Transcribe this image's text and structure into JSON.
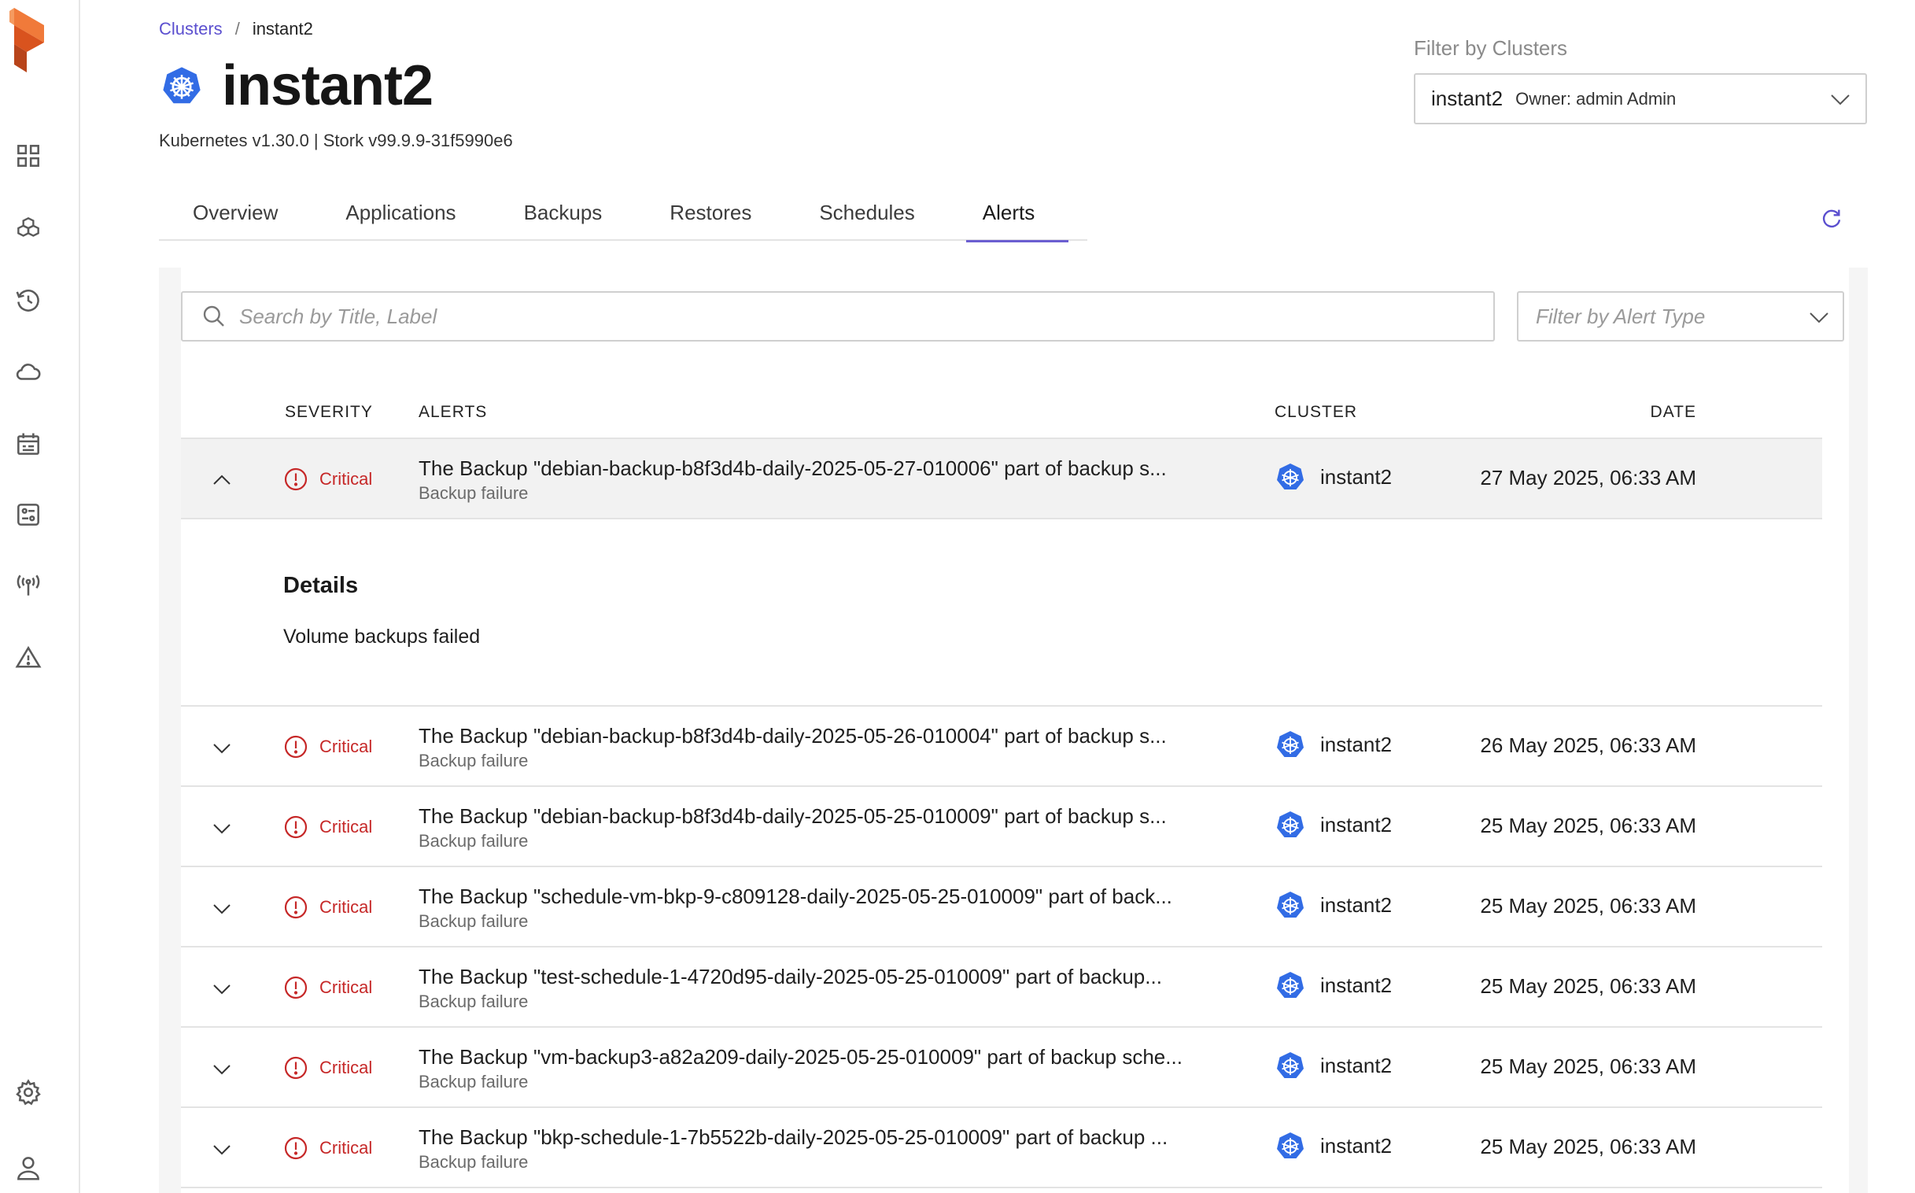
{
  "breadcrumb": {
    "parent": "Clusters",
    "separator": "/",
    "current": "instant2"
  },
  "cluster": {
    "name": "instant2",
    "version_line": "Kubernetes v1.30.0 | Stork v99.9.9-31f5990e6"
  },
  "cluster_filter": {
    "label": "Filter by Clusters",
    "selected_name": "instant2",
    "selected_owner": "Owner: admin Admin"
  },
  "tabs": [
    {
      "label": "Overview"
    },
    {
      "label": "Applications"
    },
    {
      "label": "Backups"
    },
    {
      "label": "Restores"
    },
    {
      "label": "Schedules"
    },
    {
      "label": "Alerts"
    }
  ],
  "active_tab": "Alerts",
  "search": {
    "placeholder": "Search by Title, Label"
  },
  "alert_type_filter": {
    "placeholder": "Filter by Alert Type"
  },
  "table": {
    "headers": {
      "severity": "SEVERITY",
      "alerts": "ALERTS",
      "cluster": "CLUSTER",
      "date": "DATE"
    },
    "expanded": {
      "severity": "Critical",
      "title": "The Backup \"debian-backup-b8f3d4b-daily-2025-05-27-010006\" part of backup s...",
      "type": "Backup failure",
      "cluster": "instant2",
      "date": "27 May 2025, 06:33 AM",
      "details_heading": "Details",
      "details_text": "Volume backups failed"
    },
    "rows": [
      {
        "severity": "Critical",
        "title": "The Backup \"debian-backup-b8f3d4b-daily-2025-05-26-010004\" part of backup s...",
        "type": "Backup failure",
        "cluster": "instant2",
        "date": "26 May 2025, 06:33 AM"
      },
      {
        "severity": "Critical",
        "title": "The Backup \"debian-backup-b8f3d4b-daily-2025-05-25-010009\" part of backup s...",
        "type": "Backup failure",
        "cluster": "instant2",
        "date": "25 May 2025, 06:33 AM"
      },
      {
        "severity": "Critical",
        "title": "The Backup \"schedule-vm-bkp-9-c809128-daily-2025-05-25-010009\" part of back...",
        "type": "Backup failure",
        "cluster": "instant2",
        "date": "25 May 2025, 06:33 AM"
      },
      {
        "severity": "Critical",
        "title": "The Backup \"test-schedule-1-4720d95-daily-2025-05-25-010009\" part of backup...",
        "type": "Backup failure",
        "cluster": "instant2",
        "date": "25 May 2025, 06:33 AM"
      },
      {
        "severity": "Critical",
        "title": "The Backup \"vm-backup3-a82a209-daily-2025-05-25-010009\" part of backup sche...",
        "type": "Backup failure",
        "cluster": "instant2",
        "date": "25 May 2025, 06:33 AM"
      },
      {
        "severity": "Critical",
        "title": "The Backup \"bkp-schedule-1-7b5522b-daily-2025-05-25-010009\" part of backup ...",
        "type": "Backup failure",
        "cluster": "instant2",
        "date": "25 May 2025, 06:33 AM"
      }
    ]
  },
  "colors": {
    "accent": "#6b5ed1",
    "link": "#5b4fcf",
    "critical": "#c62828",
    "k8s": "#326ce5",
    "logo": "#e8612c"
  },
  "icons": {
    "sidebar": [
      "dashboard-icon",
      "applications-icon",
      "history-icon",
      "cloud-icon",
      "calendar-icon",
      "rules-icon",
      "antenna-icon",
      "alert-icon",
      "settings-icon",
      "user-icon"
    ]
  }
}
